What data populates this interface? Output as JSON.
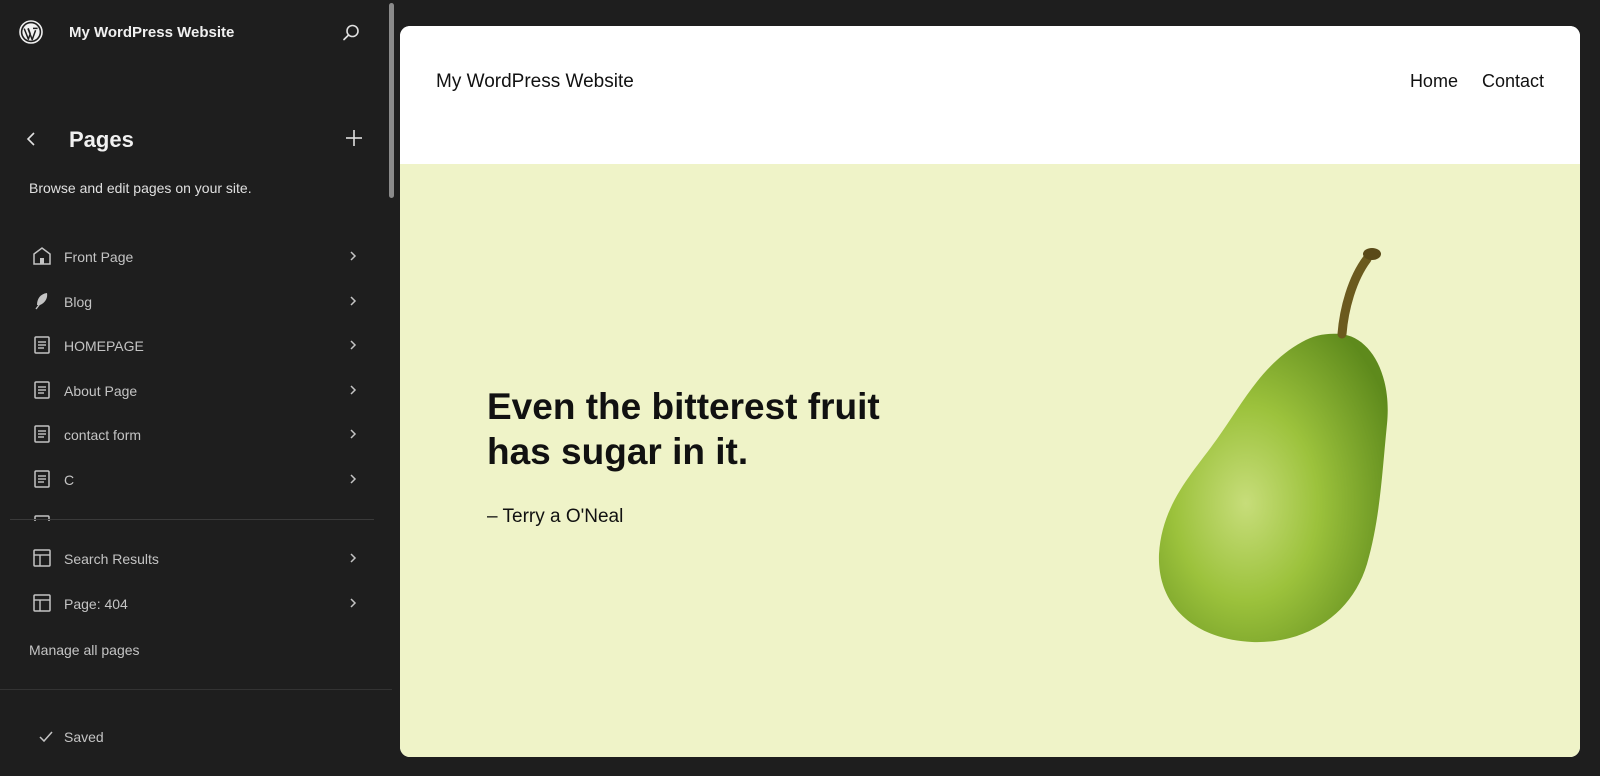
{
  "topbar": {
    "site_title": "My WordPress Website"
  },
  "sidebar": {
    "title": "Pages",
    "description": "Browse and edit pages on your site.",
    "pages": [
      {
        "label": "Front Page",
        "icon": "home-icon"
      },
      {
        "label": "Blog",
        "icon": "feather-icon"
      },
      {
        "label": "HOMEPAGE",
        "icon": "page-icon"
      },
      {
        "label": "About Page",
        "icon": "page-icon"
      },
      {
        "label": "contact form",
        "icon": "page-icon"
      },
      {
        "label": "C",
        "icon": "page-icon"
      }
    ],
    "templates": [
      {
        "label": "Search Results",
        "icon": "layout-icon"
      },
      {
        "label": "Page: 404",
        "icon": "layout-icon"
      }
    ],
    "manage_label": "Manage all pages",
    "status": "Saved"
  },
  "preview": {
    "site_title": "My WordPress Website",
    "nav": [
      "Home",
      "Contact"
    ],
    "quote": "Even the bitterest fruit has sugar in it.",
    "author": "– Terry a O'Neal",
    "hero_bg": "#eff3c8"
  },
  "colors": {
    "sidebar_bg": "#1e1e1e",
    "text_muted": "#c4c4c4",
    "text_primary": "#f0f0f0"
  }
}
